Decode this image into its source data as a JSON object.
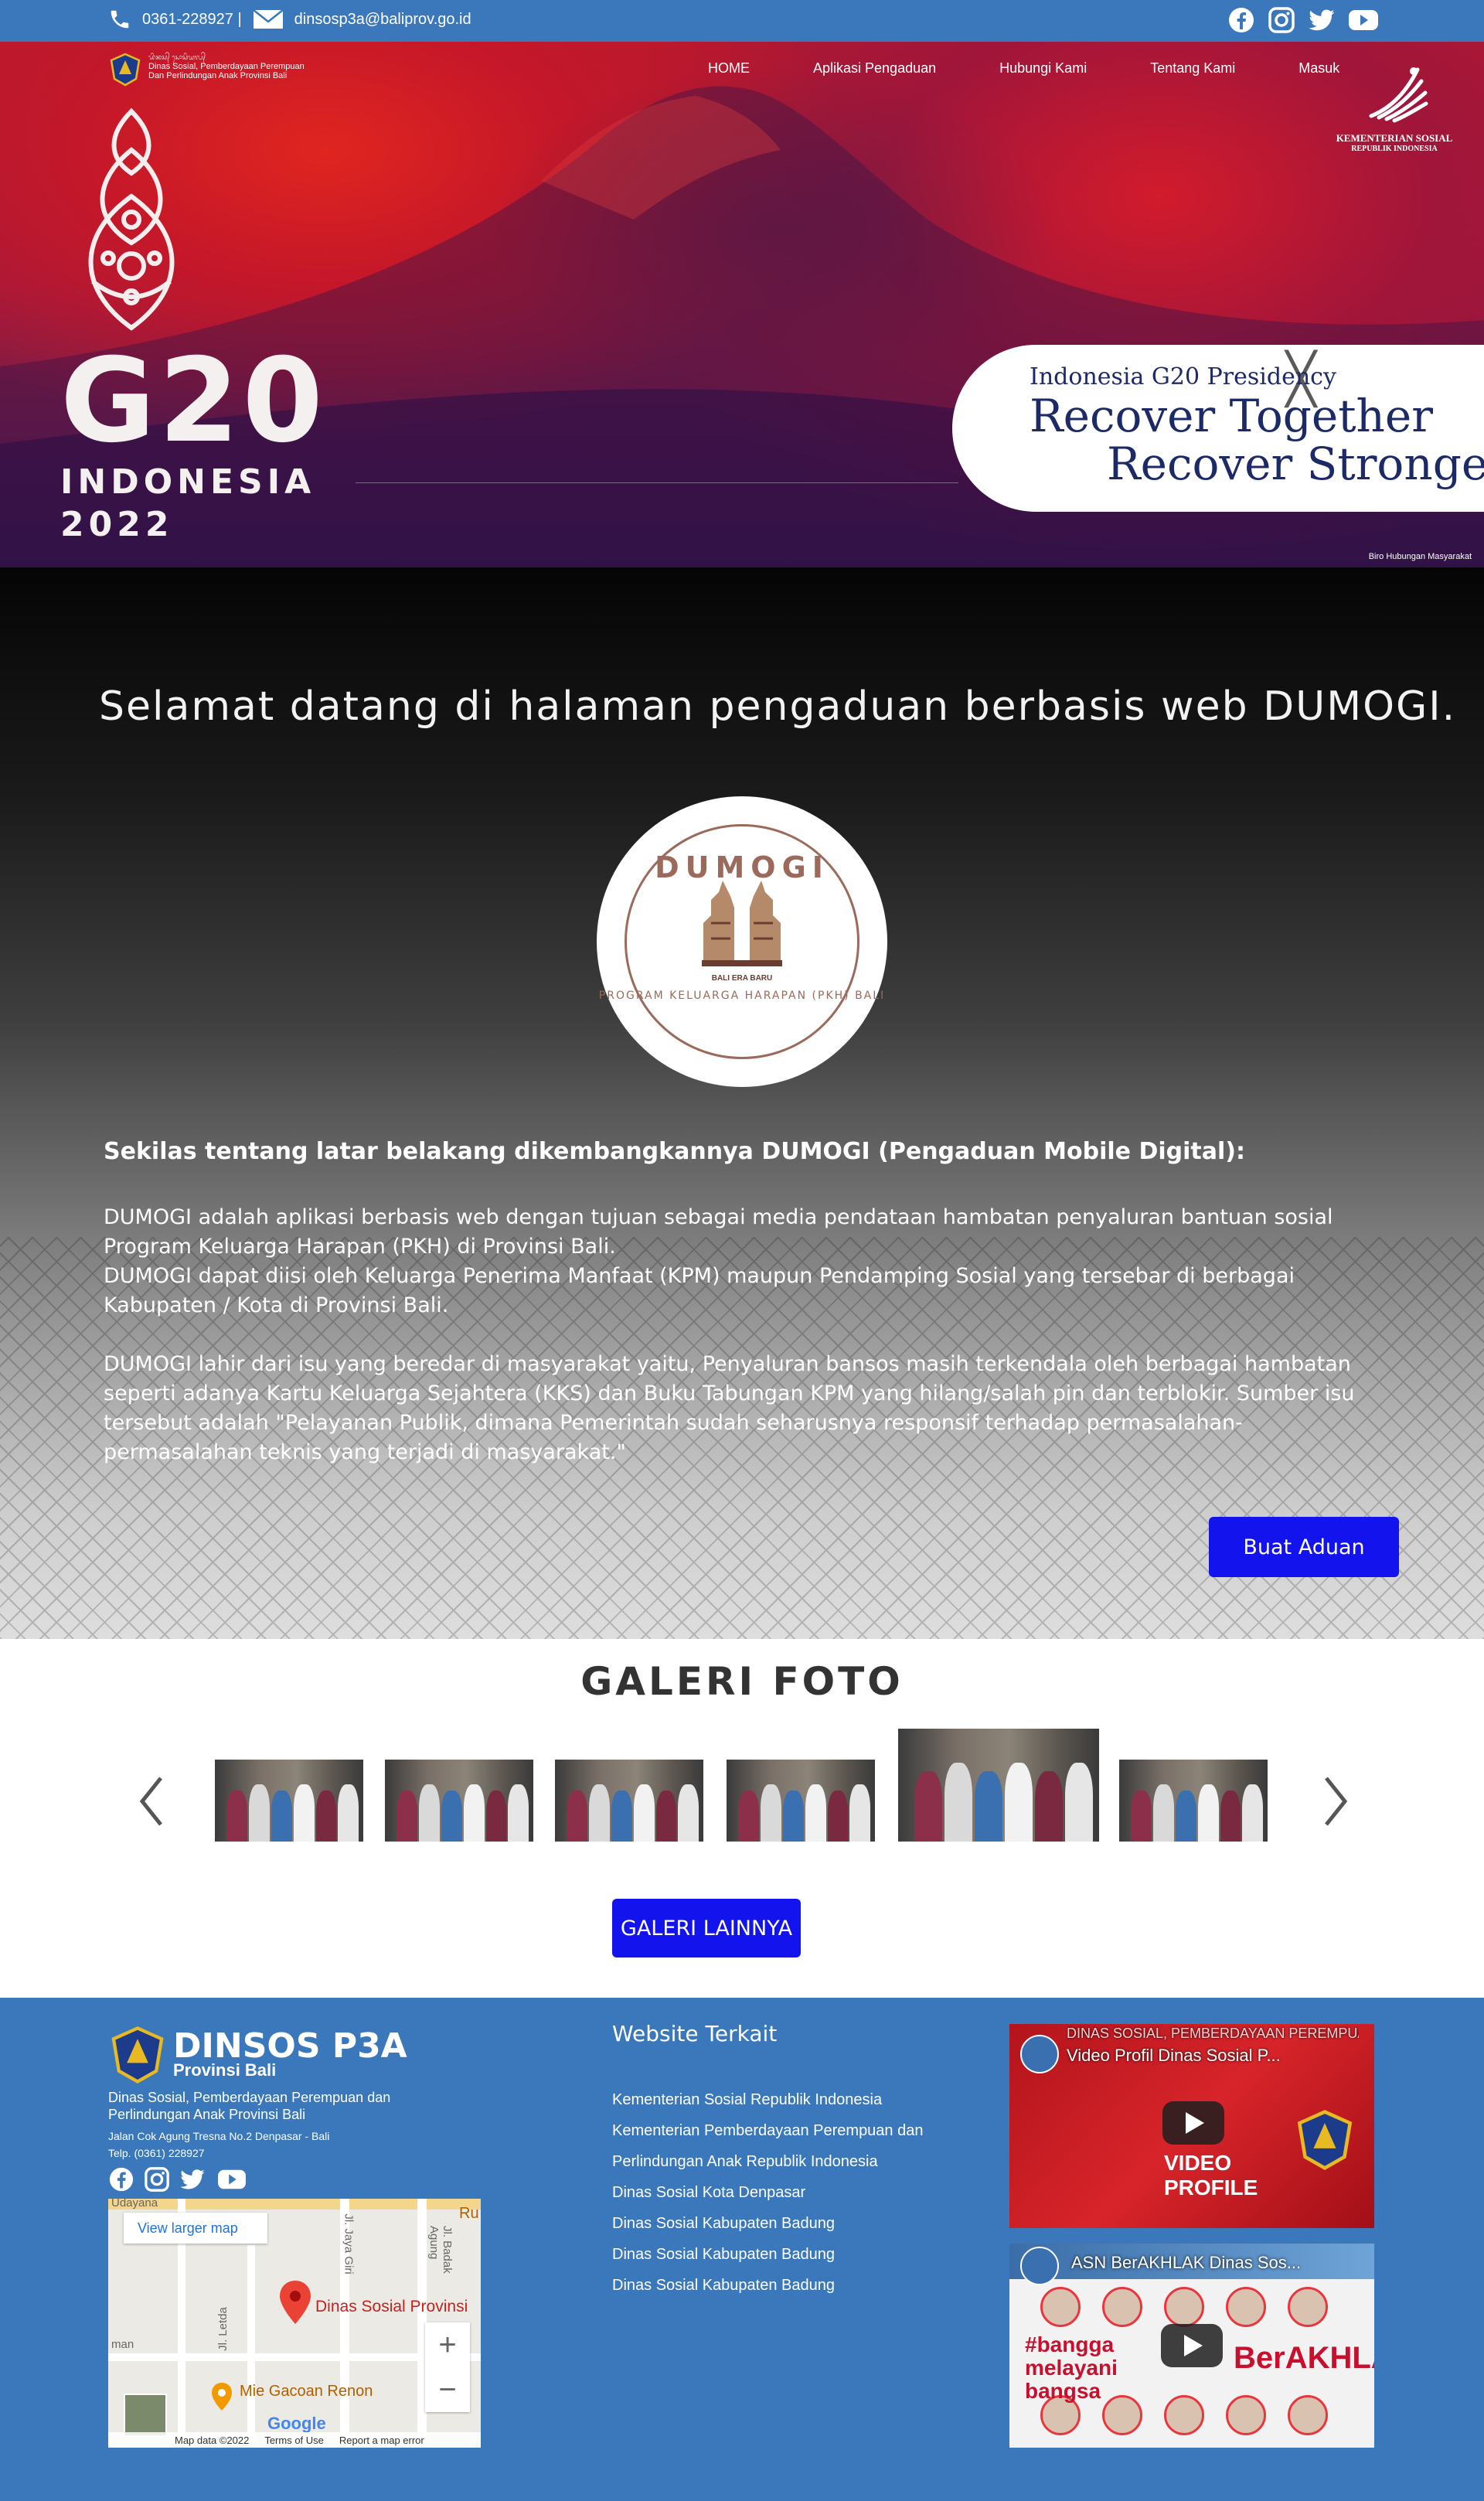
{
  "topbar": {
    "phone": "0361-228927 |",
    "email": "dinsosp3a@baliprov.go.id",
    "social_icons": [
      "facebook-icon",
      "instagram-icon",
      "twitter-icon",
      "youtube-icon"
    ]
  },
  "hero": {
    "dinas_logo_script": "ᬤᬶᬦᬲ᭄ ᬲᭀᬲᬶᬬᬮ᭄",
    "dinas_logo_line1": "Dinas Sosial, Pemberdayaan Perempuan",
    "dinas_logo_line2": "Dan Perlindungan Anak Provinsi Bali",
    "nav": [
      "HOME",
      "Aplikasi Pengaduan",
      "Hubungi Kami",
      "Tentang Kami",
      "Masuk"
    ],
    "g20_big": "G20",
    "g20_country": "INDONESIA",
    "g20_year": "2022",
    "kemensos_title": "KEMENTERIAN SOSIAL",
    "kemensos_sub": "REPUBLIK INDONESIA",
    "presidency_line1": "Indonesia G20 Presidency",
    "presidency_line2": "Recover Together",
    "presidency_line3": "Recover Stronger",
    "credit": "Biro Hubungan Masyarakat"
  },
  "intro": {
    "welcome": "Selamat datang di halaman pengaduan berbasis web DUMOGI.",
    "logo_title": "DUMOGI",
    "logo_sub": "PROGRAM KELUARGA HARAPAN (PKH) BALI",
    "logo_era": "BALI ERA BARU",
    "heading": "Sekilas tentang latar belakang dikembangkannya DUMOGI (Pengaduan Mobile Digital):",
    "para1": "DUMOGI adalah aplikasi berbasis web dengan tujuan sebagai media pendataan hambatan penyaluran bantuan sosial Program Keluarga Harapan (PKH) di Provinsi Bali.",
    "para2": "DUMOGI dapat diisi oleh Keluarga Penerima Manfaat (KPM) maupun Pendamping Sosial yang tersebar di berbagai Kabupaten / Kota di Provinsi Bali.",
    "para3": "DUMOGI lahir dari isu yang beredar di masyarakat yaitu, Penyaluran bansos masih terkendala oleh berbagai hambatan seperti adanya Kartu Keluarga Sejahtera (KKS) dan  Buku Tabungan KPM yang hilang/salah pin dan terblokir. Sumber isu tersebut adalah \"Pelayanan Publik, dimana Pemerintah sudah seharusnya responsif terhadap permasalahan-permasalahan teknis yang terjadi di masyarakat.\"",
    "button": "Buat Aduan"
  },
  "gallery": {
    "title": "GALERI FOTO",
    "button": "GALERI LAINNYA",
    "photo_count": 6
  },
  "footer": {
    "brand_name": "DINSOS P3A",
    "brand_prov": "Provinsi Bali",
    "desc": "Dinas Sosial, Pemberdayaan Perempuan dan Perlindungan Anak Provinsi Bali",
    "address": "Jalan Cok Agung Tresna No.2 Denpasar - Bali",
    "phone": "Telp. (0361) 228927",
    "map": {
      "view_larger": "View larger map",
      "place": "Dinas Sosial Provinsi",
      "place2": "Mie Gacoan Renon",
      "street1": "Udayana",
      "street2": "Jl. Letda",
      "street3": "Jl. Jaya Giri",
      "street4": "Jl. Badak Agung",
      "street5": "man",
      "street6": "Ru",
      "google": "Google",
      "attribution": [
        "Map data ©2022",
        "Terms of Use",
        "Report a map error"
      ]
    },
    "links_title": "Website Terkait",
    "links": [
      "Kementerian Sosial Republik Indonesia",
      "Kementerian Pemberdayaan Perempuan dan Perlindungan Anak Republik Indonesia",
      "Dinas Sosial Kota Denpasar",
      "Dinas Sosial Kabupaten Badung",
      "Dinas Sosial Kabupaten Badung",
      "Dinas Sosial Kabupaten Badung"
    ],
    "video1": {
      "title": "Video Profil Dinas Sosial P...",
      "banner": "DINAS SOSIAL, PEMBERDAYAAN PEREMPUAN DAN PERLINDUNGAN ANAK PROVINSI BALI",
      "big": "VIDEO PROFILE"
    },
    "video2": {
      "title": "ASN BerAKHLAK Dinas Sos...",
      "hashtag": "#bangga melayani bangsa",
      "big": "BerAKHLAK"
    }
  },
  "colors": {
    "bar_blue": "#3a78bb",
    "button_blue": "#1313ee",
    "hero_red": "#c4172a",
    "presidency_navy": "#1d2a68"
  }
}
